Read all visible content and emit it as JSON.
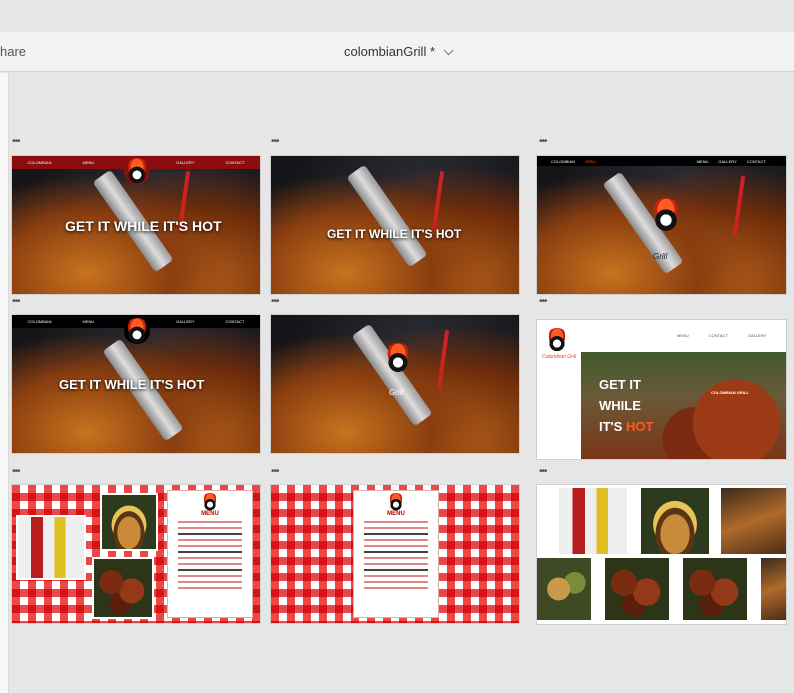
{
  "titlebar": {
    "share_label": "hare",
    "document_title": "colombianGrill *"
  },
  "boards": {
    "b1": {
      "headline": "GET IT WHILE IT'S HOT",
      "nav": [
        "COLOMBIAN",
        "MENU",
        "GALLERY",
        "CONTACT"
      ]
    },
    "b2": {
      "headline": "GET IT WHILE IT'S HOT"
    },
    "b3": {
      "nav_left": [
        "COLOMBIAN",
        "GRILL"
      ],
      "nav_right": [
        "MENU",
        "GALLERY",
        "CONTACT"
      ],
      "logo_text": "Grill"
    },
    "b4": {
      "headline": "GET IT WHILE IT'S HOT",
      "nav": [
        "COLOMBIAN",
        "MENU",
        "GALLERY",
        "CONTACT"
      ]
    },
    "b5": {
      "logo_text": "Grill"
    },
    "b6": {
      "nav": [
        "MENU",
        "CONTACT",
        "GALLERY"
      ],
      "brand": "Colombian Grill",
      "line1": "GET IT",
      "line2": "WHILE",
      "line3": "IT'S",
      "hot": "HOT",
      "tag": "COLOMBIAN GRILL"
    },
    "b7": {
      "menu_title": "MENU"
    },
    "b8": {
      "menu_title": "MENU"
    }
  },
  "colors": {
    "accent_orange": "#ff5a1f",
    "nav_red": "#8b0d0d",
    "checker_red": "#e62828"
  }
}
